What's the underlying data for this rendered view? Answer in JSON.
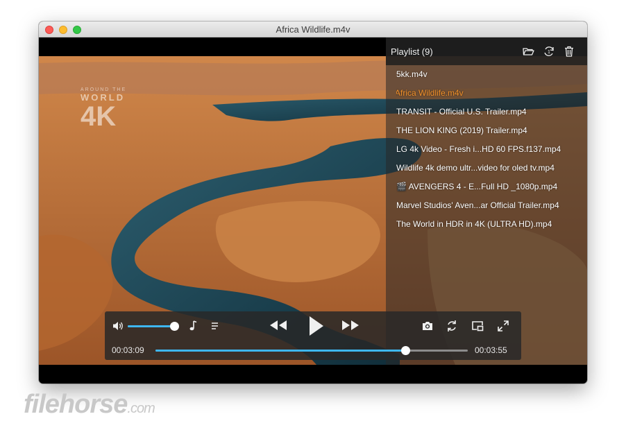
{
  "window": {
    "title": "Africa Wildlife.m4v"
  },
  "video": {
    "watermark_small": "AROUND THE",
    "watermark_world": "WORLD",
    "watermark_4k": "4K"
  },
  "playlist": {
    "title": "Playlist (9)",
    "icons": [
      "folder-open-icon",
      "repeat-one-icon",
      "trash-icon"
    ],
    "items": [
      {
        "label": "5kk.m4v",
        "active": false
      },
      {
        "label": "Africa Wildlife.m4v",
        "active": true
      },
      {
        "label": "TRANSIT - Official U.S. Trailer.mp4",
        "active": false
      },
      {
        "label": "THE LION KING (2019) Trailer.mp4",
        "active": false
      },
      {
        "label": "LG 4k Video - Fresh i...HD 60 FPS.f137.mp4",
        "active": false
      },
      {
        "label": "Wildlife 4k demo ultr...video for oled tv.mp4",
        "active": false
      },
      {
        "label": "🎬 AVENGERS 4 - E...Full HD _1080p.mp4",
        "active": false
      },
      {
        "label": "Marvel Studios' Aven...ar Official Trailer.mp4",
        "active": false
      },
      {
        "label": "The World in HDR in 4K (ULTRA HD).mp4",
        "active": false
      }
    ],
    "active_color": "#f0902a"
  },
  "controls": {
    "elapsed": "00:03:09",
    "duration": "00:03:55",
    "progress": 0.8,
    "volume": 1.0,
    "accent": "#3eb7f2",
    "icons": [
      "volume-icon",
      "audio-track-icon",
      "playlist-icon",
      "rewind-icon",
      "play-icon",
      "fast-forward-icon",
      "screenshot-icon",
      "loop-icon",
      "picture-in-picture-icon",
      "fullscreen-icon"
    ]
  },
  "watermark": {
    "brand": "filehorse",
    "suffix": ".com"
  }
}
